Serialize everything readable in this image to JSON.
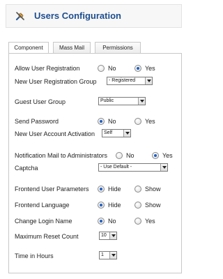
{
  "header": {
    "title": "Users Configuration",
    "icon": "tools-icon"
  },
  "tabs": [
    {
      "label": "Component",
      "active": true
    },
    {
      "label": "Mass Mail",
      "active": false
    },
    {
      "label": "Permissions",
      "active": false
    }
  ],
  "form": {
    "allow_registration": {
      "label": "Allow User Registration",
      "options": [
        "No",
        "Yes"
      ],
      "selected": "Yes"
    },
    "new_user_group": {
      "label": "New User Registration Group",
      "value": "- Registered"
    },
    "guest_group": {
      "label": "Guest User Group",
      "value": "Public"
    },
    "send_password": {
      "label": "Send Password",
      "options": [
        "No",
        "Yes"
      ],
      "selected": "No"
    },
    "new_account_activation": {
      "label": "New User Account Activation",
      "value": "Self"
    },
    "notify_admins": {
      "label": "Notification Mail to Administrators",
      "options": [
        "No",
        "Yes"
      ],
      "selected": "Yes"
    },
    "captcha": {
      "label": "Captcha",
      "value": "- Use Default -"
    },
    "frontend_params": {
      "label": "Frontend User Parameters",
      "options": [
        "Hide",
        "Show"
      ],
      "selected": "Hide"
    },
    "frontend_language": {
      "label": "Frontend Language",
      "options": [
        "Hide",
        "Show"
      ],
      "selected": "Hide"
    },
    "change_login": {
      "label": "Change Login Name",
      "options": [
        "No",
        "Yes"
      ],
      "selected": "No"
    },
    "max_reset_count": {
      "label": "Maximum Reset Count",
      "value": "10"
    },
    "time_in_hours": {
      "label": "Time in Hours",
      "value": "1"
    }
  },
  "colors": {
    "title": "#1d4e8f",
    "radio_checked": "#1e5fc2"
  }
}
